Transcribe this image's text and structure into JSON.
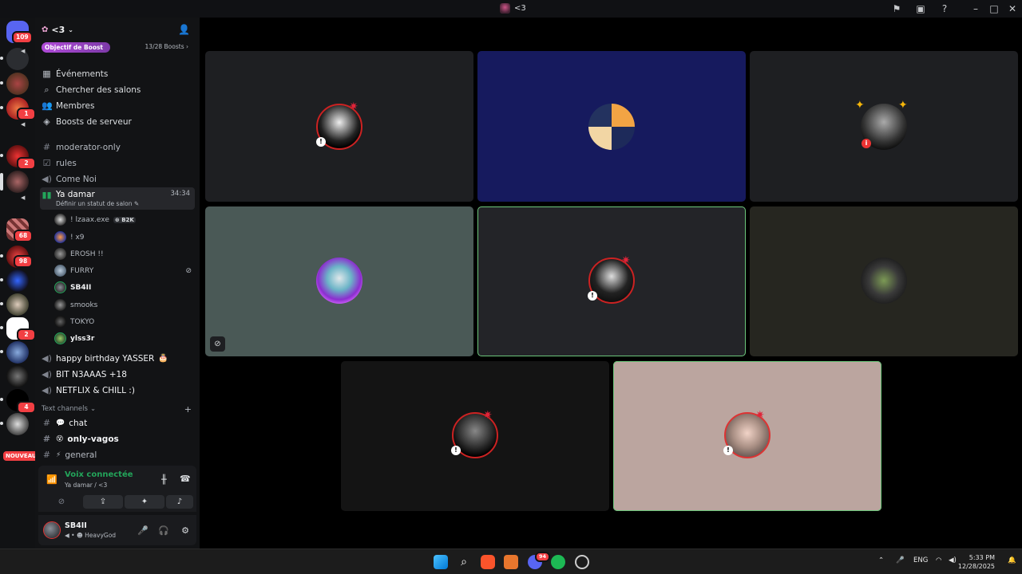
{
  "window": {
    "title": "<3"
  },
  "server": {
    "name": "<3",
    "boost_goal": "Objectif de Boost",
    "boost_count": "13/28 Boosts"
  },
  "rail": {
    "badges": [
      "109",
      "1",
      "2",
      "68",
      "98",
      "2",
      "4"
    ],
    "new_label": "NOUVEAU"
  },
  "nav": {
    "events": "Événements",
    "browse": "Chercher des salons",
    "members": "Membres",
    "boosts": "Boosts de serveur"
  },
  "channels": {
    "moderator": "moderator-only",
    "rules": "rules",
    "come_noi": "Come Noi",
    "ya_damar": "Ya damar",
    "ya_damar_timer": "34:34",
    "ya_damar_status": "Définir un statut de salon",
    "happy_birthday": "happy birthday YASSER",
    "bit": "BIT N3AAAS +18",
    "netflix": "NETFLIX & CHILL :)"
  },
  "voice_members": [
    {
      "name": "! lzaax.exe",
      "tag": "B2K"
    },
    {
      "name": "! x9"
    },
    {
      "name": "EROSH !!"
    },
    {
      "name": "FURRY"
    },
    {
      "name": "SB4II"
    },
    {
      "name": "smooks"
    },
    {
      "name": "TOKYO"
    },
    {
      "name": "ylss3r"
    }
  ],
  "text_category": {
    "label": "Text channels",
    "chat": "chat",
    "only_vagos": "only-vagos",
    "general": "general"
  },
  "voice_panel": {
    "title": "Voix connectée",
    "subtitle": "Ya damar / <3"
  },
  "user": {
    "name": "SB4II",
    "status": "HeavyGod"
  },
  "taskbar": {
    "lang": "ENG",
    "time": "5:33 PM",
    "date": "12/28/2025",
    "discord_badge": "94"
  },
  "colors": {
    "speaking_outline": "#6cc77b",
    "voice_green": "#23a55a",
    "badge_red": "#f23f43",
    "boost_purple": "#b04bd8"
  }
}
